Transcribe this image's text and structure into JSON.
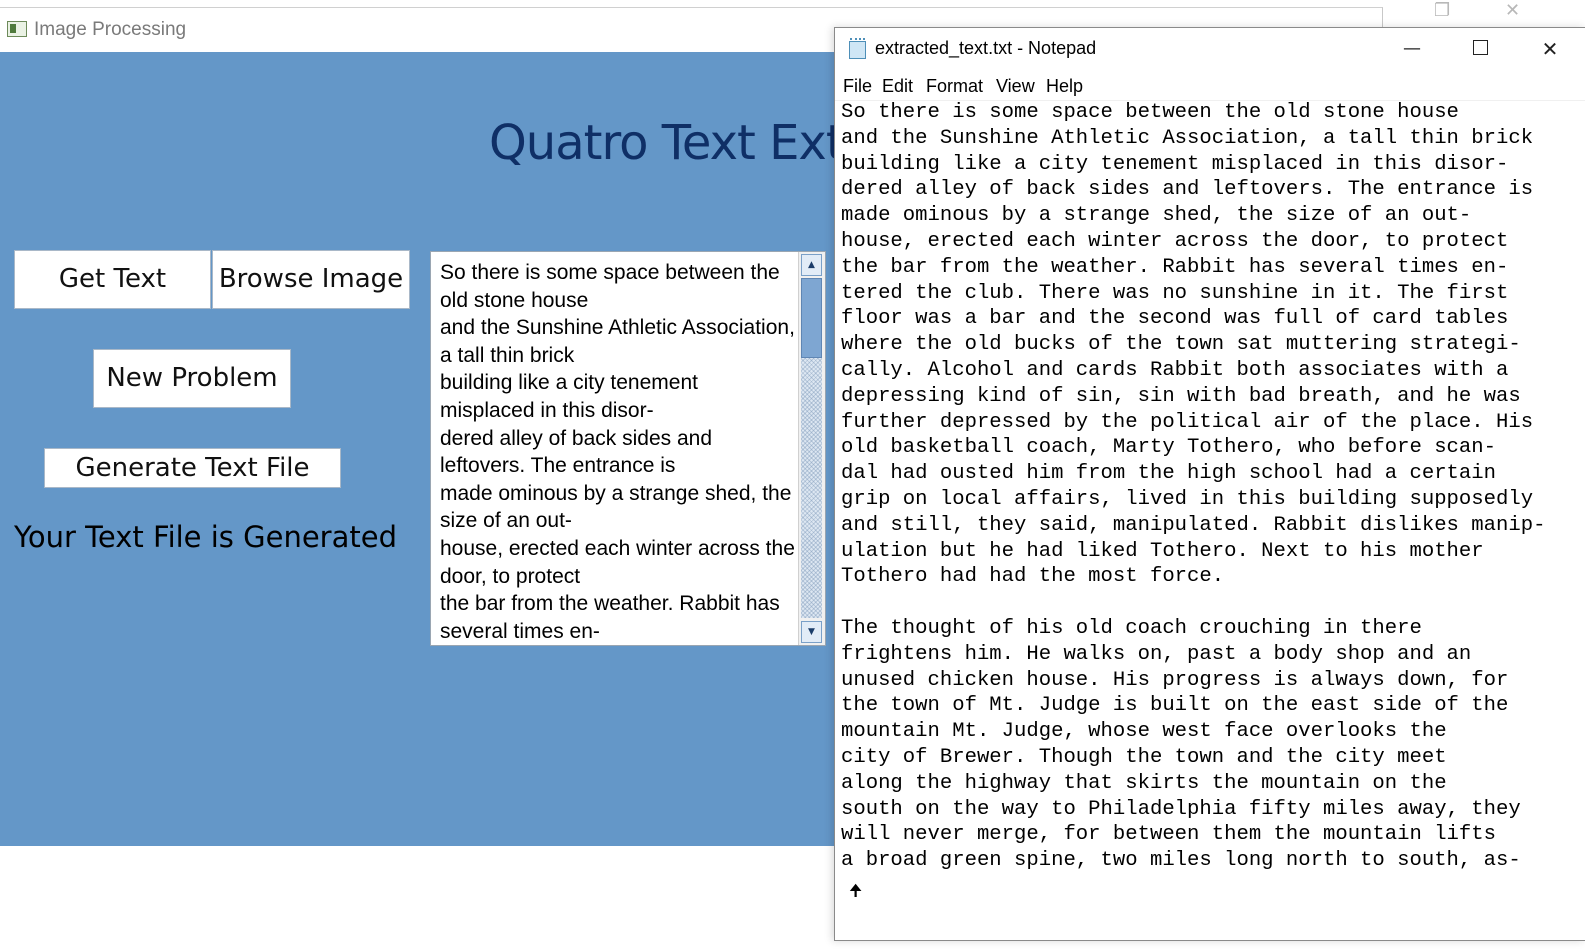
{
  "image_processing_window": {
    "title": "Image Processing",
    "heading": "Quatro Text Extr",
    "buttons": {
      "get_text": "Get Text",
      "browse_image": "Browse Image",
      "new_problem": "New Problem",
      "generate_text_file": "Generate Text File"
    },
    "status_label": "Your Text File is Generated",
    "textbox_text": "So there is some space between the old stone house\nand the Sunshine Athletic Association, a tall thin brick\nbuilding like a city tenement misplaced in this disor-\ndered alley of back sides and leftovers. The entrance is\nmade ominous by a strange shed, the size of an out-\nhouse, erected each winter across the door, to protect\nthe bar from the weather. Rabbit has several times en-"
  },
  "notepad_window": {
    "title": "extracted_text.txt - Notepad",
    "controls": {
      "minimize": "—",
      "close": "✕"
    },
    "menu": [
      "File",
      "Edit",
      "Format",
      "View",
      "Help"
    ],
    "content": "So there is some space between the old stone house\nand the Sunshine Athletic Association, a tall thin brick\nbuilding like a city tenement misplaced in this disor-\ndered alley of back sides and leftovers. The entrance is\nmade ominous by a strange shed, the size of an out-\nhouse, erected each winter across the door, to protect\nthe bar from the weather. Rabbit has several times en-\ntered the club. There was no sunshine in it. The first\nfloor was a bar and the second was full of card tables\nwhere the old bucks of the town sat muttering strategi-\ncally. Alcohol and cards Rabbit both associates with a\ndepressing kind of sin, sin with bad breath, and he was\nfurther depressed by the political air of the place. His\nold basketball coach, Marty Tothero, who before scan-\ndal had ousted him from the high school had a certain\ngrip on local affairs, lived in this building supposedly\nand still, they said, manipulated. Rabbit dislikes manip-\nulation but he had liked Tothero. Next to his mother\nTothero had had the most force.\n\nThe thought of his old coach crouching in there\nfrightens him. He walks on, past a body shop and an\nunused chicken house. His progress is always down, for\nthe town of Mt. Judge is built on the east side of the\nmountain Mt. Judge, whose west face overlooks the\ncity of Brewer. Though the town and the city meet\nalong the highway that skirts the mountain on the\nsouth on the way to Philadelphia fifty miles away, they\nwill never merge, for between them the mountain lifts\na broad green spine, two miles long north to south, as-"
  },
  "colors": {
    "client_background": "#6497c8",
    "heading_color": "#0f2f66"
  },
  "icons": {
    "image_processing_app": "app-window-icon",
    "notepad_app": "notepad-icon",
    "text_cursor": "mouse-cursor-icon"
  }
}
